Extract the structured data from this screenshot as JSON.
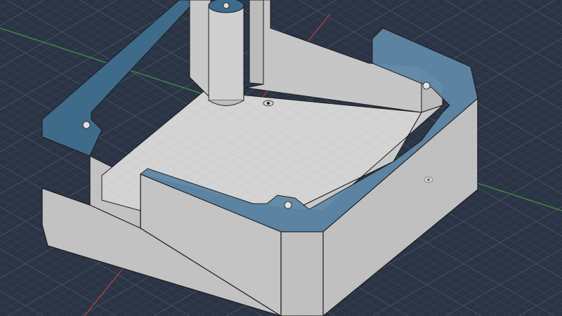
{
  "viewport": {
    "name": "3d-cad-viewport",
    "background": "#2b3445",
    "grid_minor_color": "#3a4556",
    "grid_major_color": "#4a5668",
    "x_axis_color": "#c0403a",
    "y_axis_color": "#3f9a3f"
  },
  "model": {
    "name": "enclosure-box",
    "body_color": "#c9c9c9",
    "floor_color": "#d6d6d6",
    "section_face_color": "#3e6b8a",
    "section_face_highlight": "#5f88a6",
    "edge_color": "#1a1a1a",
    "hole_count": 6
  }
}
